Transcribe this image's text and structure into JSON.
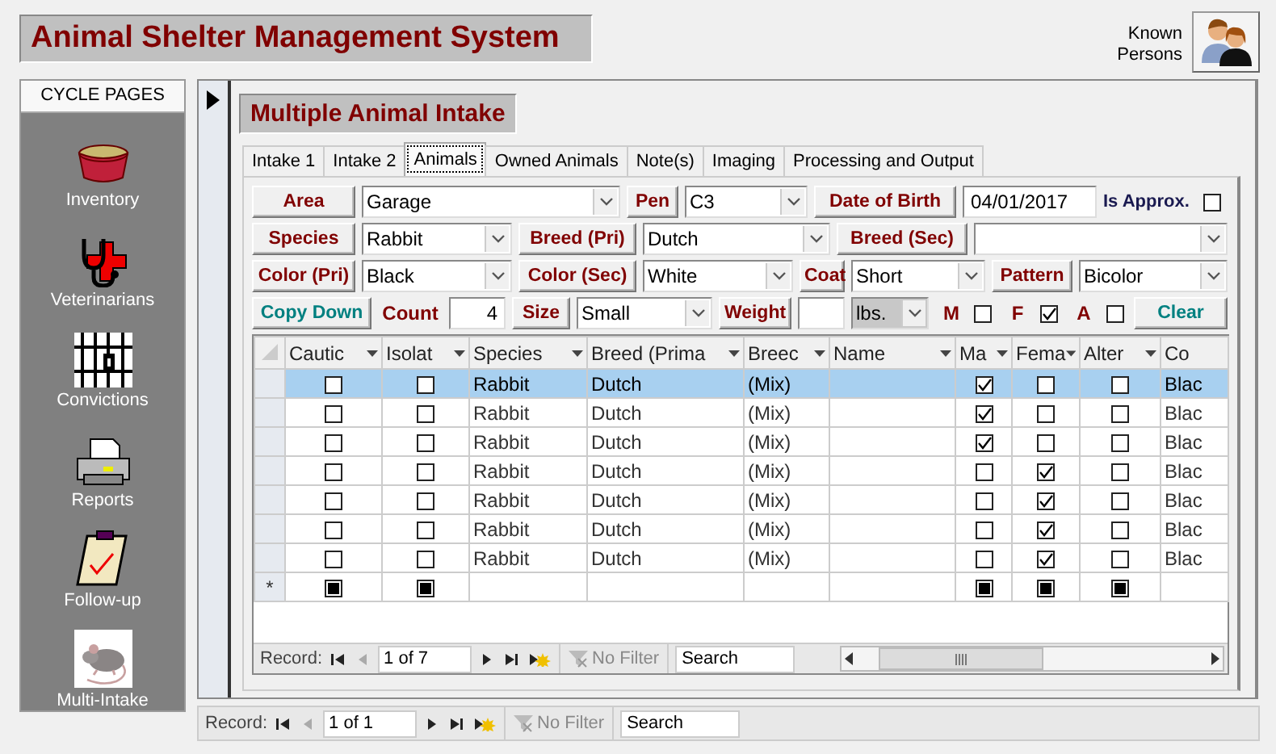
{
  "app_title": "Animal Shelter Management System",
  "known_persons": {
    "label": "Known Persons"
  },
  "sidebar": {
    "header": "CYCLE PAGES",
    "items": [
      {
        "label": "Inventory",
        "kind": "bowl"
      },
      {
        "label": "Veterinarians",
        "kind": "stethoscope"
      },
      {
        "label": "Convictions",
        "kind": "bars"
      },
      {
        "label": "Reports",
        "kind": "printer"
      },
      {
        "label": "Follow-up",
        "kind": "clipboard"
      },
      {
        "label": "Multi-Intake",
        "kind": "mouse"
      }
    ]
  },
  "form": {
    "title": "Multiple Animal Intake",
    "tabs": [
      {
        "label": "Intake 1",
        "selected": false
      },
      {
        "label": "Intake 2",
        "selected": false
      },
      {
        "label": "Animals",
        "selected": true
      },
      {
        "label": "Owned Animals",
        "selected": false
      },
      {
        "label": "Note(s)",
        "selected": false
      },
      {
        "label": "Imaging",
        "selected": false
      },
      {
        "label": "Processing and Output",
        "selected": false
      }
    ],
    "field_rows": [
      [
        {
          "kind": "field_button",
          "label": "Area"
        },
        {
          "kind": "combo",
          "value": "Garage",
          "disabled": false
        },
        {
          "kind": "field_button",
          "label": "Pen"
        },
        {
          "kind": "combo",
          "value": "C3",
          "disabled": false
        },
        {
          "kind": "field_button",
          "label": "Date of Birth"
        },
        {
          "kind": "text",
          "value": "04/01/2017"
        },
        {
          "kind": "caption",
          "label": "Is Approx."
        },
        {
          "kind": "check",
          "checked": false
        }
      ],
      [
        {
          "kind": "field_button",
          "label": "Species"
        },
        {
          "kind": "combo",
          "value": "Rabbit",
          "disabled": false
        },
        {
          "kind": "field_button",
          "label": "Breed (Pri)"
        },
        {
          "kind": "combo",
          "value": "Dutch",
          "disabled": false
        },
        {
          "kind": "field_button",
          "label": "Breed (Sec)"
        },
        {
          "kind": "combo",
          "disabled": false
        }
      ],
      [
        {
          "kind": "field_button",
          "label": "Color (Pri)"
        },
        {
          "kind": "combo",
          "value": "Black",
          "disabled": false
        },
        {
          "kind": "field_button",
          "label": "Color (Sec)"
        },
        {
          "kind": "combo",
          "value": "White",
          "disabled": false
        },
        {
          "kind": "field_button",
          "label": "Coat"
        },
        {
          "kind": "combo",
          "value": "Short",
          "disabled": false
        },
        {
          "kind": "field_button",
          "label": "Pattern"
        },
        {
          "kind": "combo",
          "value": "Bicolor",
          "disabled": false
        }
      ],
      [
        {
          "kind": "action_button",
          "label": "Copy Down"
        },
        {
          "kind": "label",
          "label": "Count"
        },
        {
          "kind": "number",
          "value": "4"
        },
        {
          "kind": "field_button",
          "label": "Size"
        },
        {
          "kind": "combo",
          "value": "Small",
          "disabled": false
        },
        {
          "kind": "field_button",
          "label": "Weight"
        },
        {
          "kind": "text"
        },
        {
          "kind": "combo",
          "value": "lbs.",
          "disabled": true
        },
        {
          "kind": "label",
          "label": "M"
        },
        {
          "kind": "check",
          "checked": false
        },
        {
          "kind": "label",
          "label": "F"
        },
        {
          "kind": "check",
          "checked": true
        },
        {
          "kind": "label",
          "label": "A"
        },
        {
          "kind": "check",
          "checked": false
        },
        {
          "kind": "action_button",
          "label": "Clear"
        }
      ]
    ],
    "grid": {
      "columns": [
        {
          "label": "Cautic"
        },
        {
          "label": "Isolat"
        },
        {
          "label": "Species"
        },
        {
          "label": "Breed (Prima"
        },
        {
          "label": "Breec"
        },
        {
          "label": "Name"
        },
        {
          "label": "Ma"
        },
        {
          "label": "Fema"
        },
        {
          "label": "Alter"
        },
        {
          "label": "Co"
        }
      ],
      "rows": [
        {
          "selected": true,
          "cells": [
            {
              "kind": "check",
              "checked": false
            },
            {
              "kind": "check",
              "checked": false
            },
            {
              "kind": "text",
              "value": "Rabbit"
            },
            {
              "kind": "text",
              "value": "Dutch"
            },
            {
              "kind": "text",
              "value": "(Mix)"
            },
            {
              "kind": "blank"
            },
            {
              "kind": "check",
              "checked": true
            },
            {
              "kind": "check",
              "checked": false
            },
            {
              "kind": "check",
              "checked": false
            },
            {
              "kind": "text",
              "value": "Blac"
            }
          ]
        },
        {
          "selected": false,
          "cells": [
            {
              "kind": "check",
              "checked": false
            },
            {
              "kind": "check",
              "checked": false
            },
            {
              "kind": "text",
              "value": "Rabbit"
            },
            {
              "kind": "text",
              "value": "Dutch"
            },
            {
              "kind": "text",
              "value": "(Mix)"
            },
            {
              "kind": "blank"
            },
            {
              "kind": "check",
              "checked": true
            },
            {
              "kind": "check",
              "checked": false
            },
            {
              "kind": "check",
              "checked": false
            },
            {
              "kind": "text",
              "value": "Blac"
            }
          ]
        },
        {
          "selected": false,
          "cells": [
            {
              "kind": "check",
              "checked": false
            },
            {
              "kind": "check",
              "checked": false
            },
            {
              "kind": "text",
              "value": "Rabbit"
            },
            {
              "kind": "text",
              "value": "Dutch"
            },
            {
              "kind": "text",
              "value": "(Mix)"
            },
            {
              "kind": "blank"
            },
            {
              "kind": "check",
              "checked": true
            },
            {
              "kind": "check",
              "checked": false
            },
            {
              "kind": "check",
              "checked": false
            },
            {
              "kind": "text",
              "value": "Blac"
            }
          ]
        },
        {
          "selected": false,
          "cells": [
            {
              "kind": "check",
              "checked": false
            },
            {
              "kind": "check",
              "checked": false
            },
            {
              "kind": "text",
              "value": "Rabbit"
            },
            {
              "kind": "text",
              "value": "Dutch"
            },
            {
              "kind": "text",
              "value": "(Mix)"
            },
            {
              "kind": "blank"
            },
            {
              "kind": "check",
              "checked": false
            },
            {
              "kind": "check",
              "checked": true
            },
            {
              "kind": "check",
              "checked": false
            },
            {
              "kind": "text",
              "value": "Blac"
            }
          ]
        },
        {
          "selected": false,
          "cells": [
            {
              "kind": "check",
              "checked": false
            },
            {
              "kind": "check",
              "checked": false
            },
            {
              "kind": "text",
              "value": "Rabbit"
            },
            {
              "kind": "text",
              "value": "Dutch"
            },
            {
              "kind": "text",
              "value": "(Mix)"
            },
            {
              "kind": "blank"
            },
            {
              "kind": "check",
              "checked": false
            },
            {
              "kind": "check",
              "checked": true
            },
            {
              "kind": "check",
              "checked": false
            },
            {
              "kind": "text",
              "value": "Blac"
            }
          ]
        },
        {
          "selected": false,
          "cells": [
            {
              "kind": "check",
              "checked": false
            },
            {
              "kind": "check",
              "checked": false
            },
            {
              "kind": "text",
              "value": "Rabbit"
            },
            {
              "kind": "text",
              "value": "Dutch"
            },
            {
              "kind": "text",
              "value": "(Mix)"
            },
            {
              "kind": "blank"
            },
            {
              "kind": "check",
              "checked": false
            },
            {
              "kind": "check",
              "checked": true
            },
            {
              "kind": "check",
              "checked": false
            },
            {
              "kind": "text",
              "value": "Blac"
            }
          ]
        },
        {
          "selected": false,
          "cells": [
            {
              "kind": "check",
              "checked": false
            },
            {
              "kind": "check",
              "checked": false
            },
            {
              "kind": "text",
              "value": "Rabbit"
            },
            {
              "kind": "text",
              "value": "Dutch"
            },
            {
              "kind": "text",
              "value": "(Mix)"
            },
            {
              "kind": "blank"
            },
            {
              "kind": "check",
              "checked": false
            },
            {
              "kind": "check",
              "checked": true
            },
            {
              "kind": "check",
              "checked": false
            },
            {
              "kind": "text",
              "value": "Blac"
            }
          ]
        }
      ],
      "new_row": {
        "marker": "*",
        "cells": [
          {
            "kind": "check",
            "indeterminate": true
          },
          {
            "kind": "check",
            "indeterminate": true
          },
          {
            "kind": "blank"
          },
          {
            "kind": "blank"
          },
          {
            "kind": "blank"
          },
          {
            "kind": "blank"
          },
          {
            "kind": "check",
            "indeterminate": true
          },
          {
            "kind": "check",
            "indeterminate": true
          },
          {
            "kind": "check",
            "indeterminate": true
          },
          {
            "kind": "blank"
          }
        ]
      },
      "navigator": {
        "label": "Record:",
        "position": "1 of 7",
        "filter": "No Filter",
        "search": "Search"
      }
    }
  },
  "navigator": {
    "label": "Record:",
    "position": "1 of 1",
    "filter": "No Filter",
    "search": "Search"
  }
}
